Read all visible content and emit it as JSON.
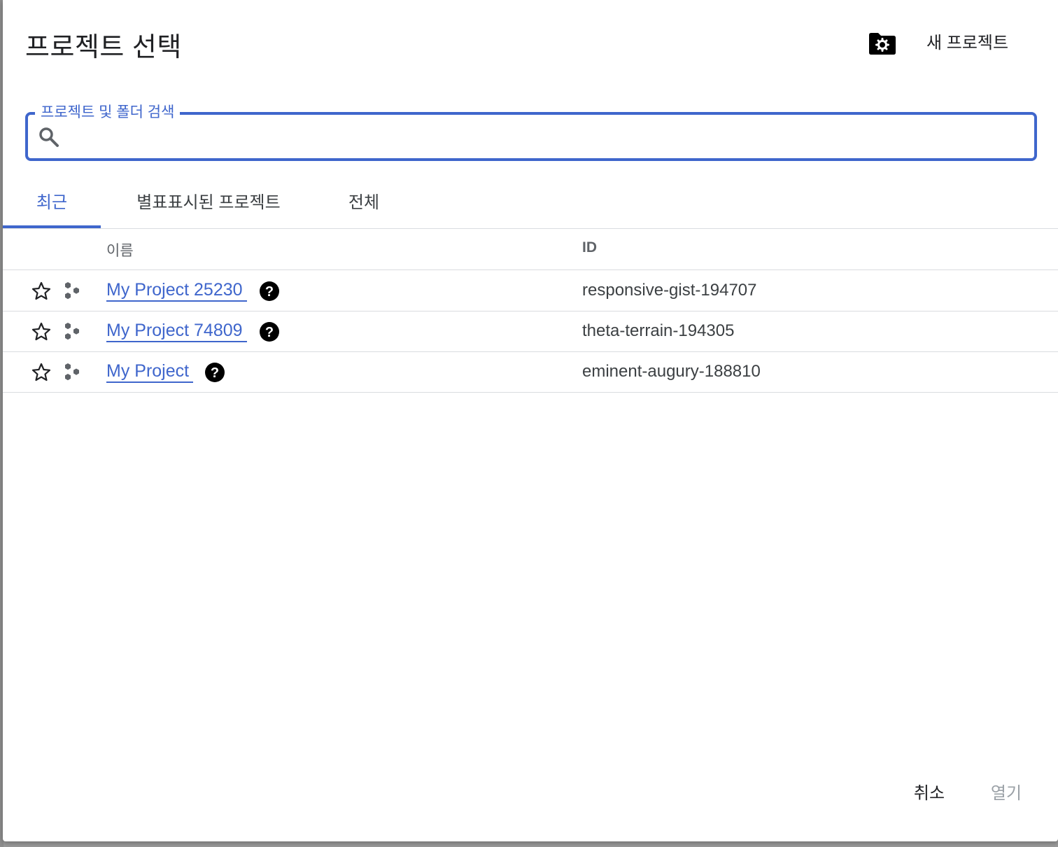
{
  "dialog": {
    "title": "프로젝트 선택",
    "new_project_label": "새 프로젝트"
  },
  "search": {
    "label": "프로젝트 및 폴더 검색",
    "value": "",
    "placeholder": ""
  },
  "tabs": [
    {
      "label": "최근",
      "active": true
    },
    {
      "label": "별표표시된 프로젝트",
      "active": false
    },
    {
      "label": "전체",
      "active": false
    }
  ],
  "table": {
    "columns": {
      "name": "이름",
      "id": "ID"
    },
    "rows": [
      {
        "name": "My Project 25230",
        "id": "responsive-gist-194707"
      },
      {
        "name": "My Project 74809",
        "id": "theta-terrain-194305"
      },
      {
        "name": "My Project",
        "id": "eminent-augury-188810"
      }
    ]
  },
  "footer": {
    "cancel_label": "취소",
    "open_label": "열기"
  },
  "colors": {
    "accent": "#3f66cc",
    "text_primary": "#202124",
    "text_secondary": "#5f6368",
    "disabled": "#9aa0a6",
    "divider": "#dadce0"
  },
  "icons": {
    "new_project": "folder-gear-icon",
    "search": "search-icon",
    "star": "star-outline-icon",
    "project_type": "project-hexagons-icon",
    "help": "help-circle-icon"
  }
}
